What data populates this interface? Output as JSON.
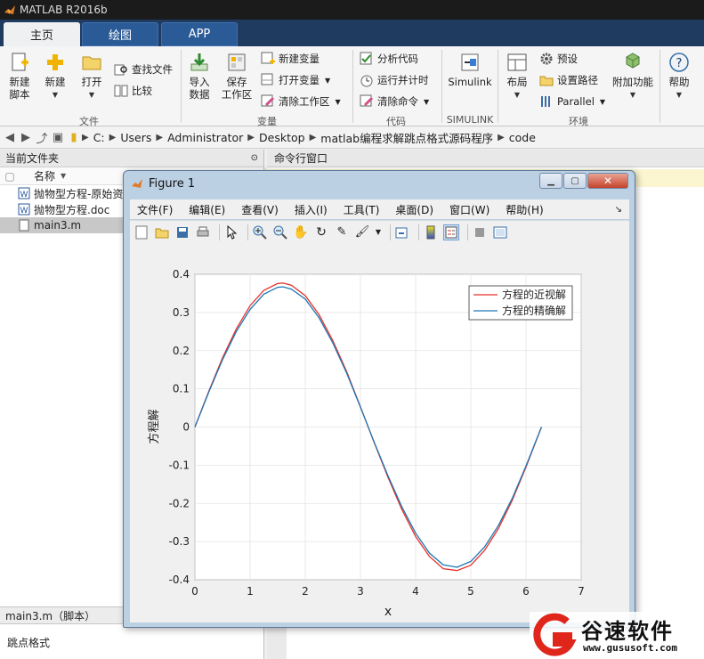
{
  "app": {
    "title": "MATLAB R2016b"
  },
  "tabs": [
    {
      "label": "主页",
      "active": true
    },
    {
      "label": "绘图",
      "active": false
    },
    {
      "label": "APP",
      "active": false
    }
  ],
  "ribbon": {
    "file": {
      "new_script": "新建\n脚本",
      "new": "新建",
      "open": "打开",
      "find_files": "查找文件",
      "compare": "比较",
      "group": "文件"
    },
    "variable": {
      "import": "导入\n数据",
      "save_ws": "保存\n工作区",
      "new_var": "新建变量",
      "open_var": "打开变量",
      "clear_ws": "清除工作区",
      "group": "变量"
    },
    "code": {
      "analyze": "分析代码",
      "run_time": "运行并计时",
      "clear_cmd": "清除命令",
      "group": "代码"
    },
    "simulink": {
      "label": "Simulink",
      "group": "SIMULINK"
    },
    "env": {
      "layout": "布局",
      "prefs": "预设",
      "set_path": "设置路径",
      "parallel": "Parallel",
      "addons": "附加功能",
      "group": "环境"
    },
    "help": "帮助"
  },
  "address": {
    "crumbs": [
      "C:",
      "Users",
      "Administrator",
      "Desktop",
      "matlab编程求解跳点格式源码程序",
      "code"
    ]
  },
  "left_panel": {
    "title": "当前文件夹",
    "col_name": "名称",
    "files": [
      {
        "name": "抛物型方程-原始资",
        "icon": "word-doc-icon",
        "selected": false
      },
      {
        "name": "抛物型方程.doc",
        "icon": "word-doc-icon",
        "selected": false
      },
      {
        "name": "main3.m",
        "icon": "m-file-icon",
        "selected": true
      }
    ],
    "detail_title": "main3.m（脚本）",
    "detail_text": "跳点格式"
  },
  "cmd_panel": {
    "title": "命令行窗口"
  },
  "figure": {
    "title": "Figure 1",
    "menu": [
      "文件(F)",
      "编辑(E)",
      "查看(V)",
      "插入(I)",
      "工具(T)",
      "桌面(D)",
      "窗口(W)",
      "帮助(H)"
    ]
  },
  "chart_data": {
    "type": "line",
    "title": "",
    "xlabel": "x",
    "ylabel": "方程解",
    "xlim": [
      0,
      7
    ],
    "ylim": [
      -0.4,
      0.4
    ],
    "xticks": [
      "0",
      "1",
      "2",
      "3",
      "4",
      "5",
      "6",
      "7"
    ],
    "yticks": [
      "-0.4",
      "-0.3",
      "-0.2",
      "-0.1",
      "0",
      "0.1",
      "0.2",
      "0.3",
      "0.4"
    ],
    "grid": true,
    "legend_position": "top-right",
    "series": [
      {
        "name": "方程的近视解",
        "color": "#e8302a",
        "x": [
          0,
          0.25,
          0.5,
          0.75,
          1.0,
          1.25,
          1.5,
          1.6,
          1.75,
          2.0,
          2.25,
          2.5,
          2.75,
          3.0,
          3.25,
          3.5,
          3.75,
          4.0,
          4.25,
          4.5,
          4.75,
          5.0,
          5.25,
          5.5,
          5.75,
          6.0,
          6.28
        ],
        "y": [
          0,
          0.093,
          0.181,
          0.257,
          0.318,
          0.358,
          0.376,
          0.377,
          0.371,
          0.344,
          0.294,
          0.226,
          0.145,
          0.053,
          -0.041,
          -0.132,
          -0.216,
          -0.287,
          -0.339,
          -0.371,
          -0.376,
          -0.362,
          -0.323,
          -0.266,
          -0.192,
          -0.105,
          0
        ]
      },
      {
        "name": "方程的精确解",
        "color": "#1f77b4",
        "x": [
          0,
          0.25,
          0.5,
          0.75,
          1.0,
          1.25,
          1.5,
          1.6,
          1.75,
          2.0,
          2.25,
          2.5,
          2.75,
          3.0,
          3.25,
          3.5,
          3.75,
          4.0,
          4.25,
          4.5,
          4.75,
          5.0,
          5.25,
          5.5,
          5.75,
          6.0,
          6.28
        ],
        "y": [
          0,
          0.091,
          0.176,
          0.25,
          0.308,
          0.348,
          0.366,
          0.367,
          0.361,
          0.335,
          0.286,
          0.22,
          0.141,
          0.052,
          -0.04,
          -0.128,
          -0.209,
          -0.278,
          -0.33,
          -0.361,
          -0.367,
          -0.352,
          -0.314,
          -0.258,
          -0.187,
          -0.102,
          0
        ]
      }
    ]
  },
  "watermark": {
    "brand": "谷速软件",
    "url": "www.gususoft.com"
  }
}
